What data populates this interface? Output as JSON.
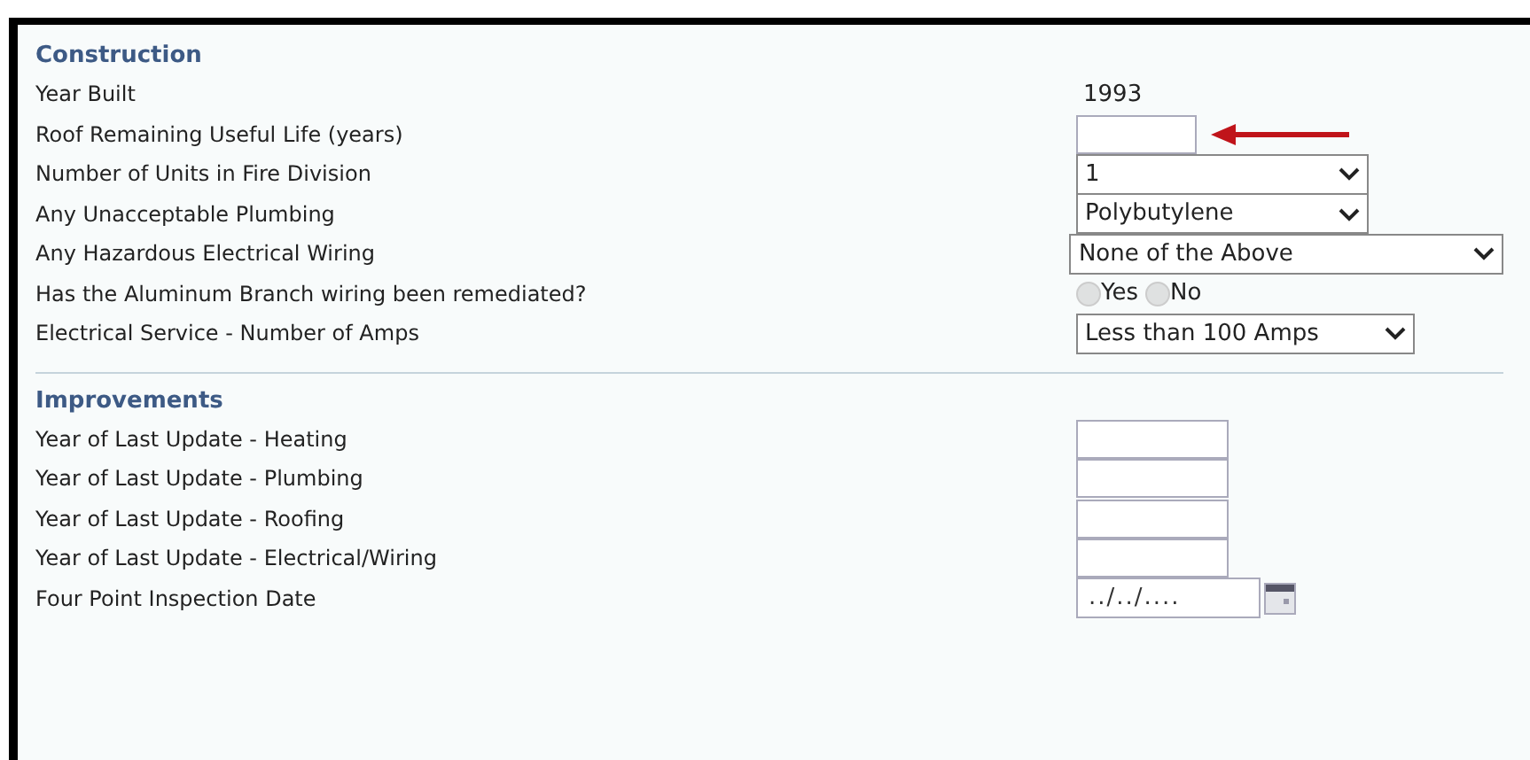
{
  "sections": [
    {
      "title": "Construction",
      "rows": [
        {
          "label": "Year Built",
          "kind": "text",
          "value": "1993"
        },
        {
          "label": "Roof Remaining Useful Life (years)",
          "kind": "input",
          "arrow": true
        },
        {
          "label": "Number of Units in Fire Division",
          "kind": "select",
          "value": "1"
        },
        {
          "label": "Any Unacceptable Plumbing",
          "kind": "select",
          "value": "Polybutylene"
        },
        {
          "label": "Any Hazardous Electrical Wiring",
          "kind": "select",
          "value": "None of the Above"
        },
        {
          "label": "Has the Aluminum Branch wiring been remediated?",
          "kind": "radio",
          "options": [
            {
              "label": "Yes",
              "selected": false
            },
            {
              "label": "No",
              "selected": false
            }
          ]
        },
        {
          "label": "Electrical Service - Number of Amps",
          "kind": "select",
          "value": "Less than 100 Amps"
        }
      ]
    },
    {
      "title": "Improvements",
      "rows": [
        {
          "label": "Year of Last Update - Heating",
          "kind": "input",
          "arrow": false
        },
        {
          "label": "Year of Last Update - Plumbing",
          "kind": "input",
          "arrow": false
        },
        {
          "label": "Year of Last Update - Roofing",
          "kind": "input",
          "arrow": false
        },
        {
          "label": "Year of Last Update - Electrical/Wiring",
          "kind": "input",
          "arrow": false
        },
        {
          "label": "Four Point Inspection Date",
          "kind": "date",
          "value": "../../...."
        }
      ]
    }
  ]
}
